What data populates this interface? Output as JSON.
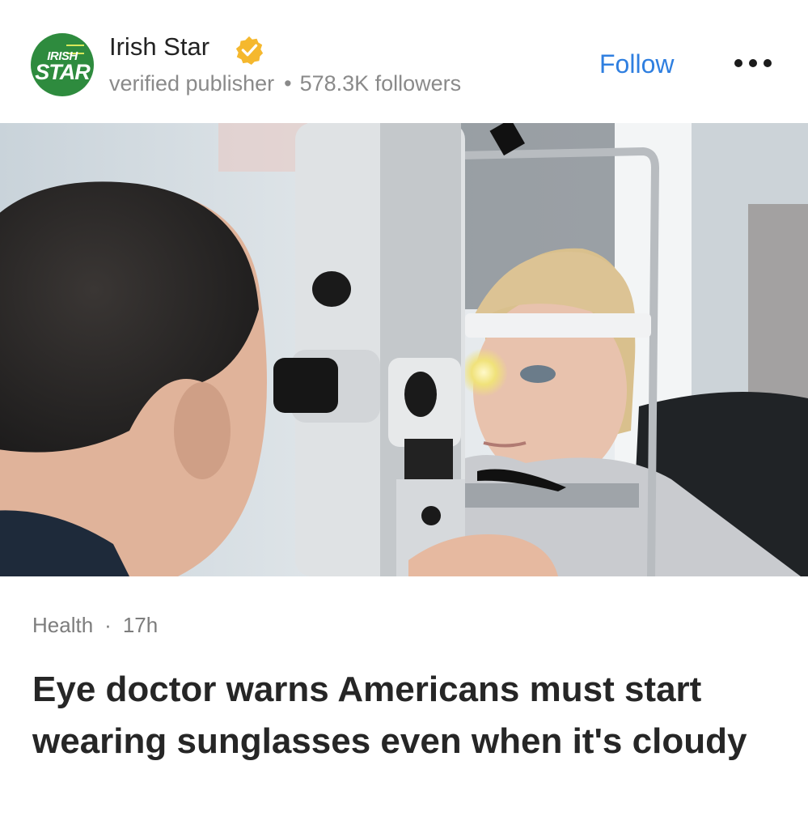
{
  "publisher": {
    "logo_top": "IRISH",
    "logo_bottom": "STAR",
    "name": "Irish Star",
    "verified_icon": "verified-badge-icon",
    "label": "verified publisher",
    "separator": "•",
    "followers": "578.3K followers",
    "follow_label": "Follow",
    "more_icon": "more-horizontal-icon"
  },
  "article": {
    "category": "Health",
    "separator": "·",
    "age": "17h",
    "headline": "Eye doctor warns Americans must start wearing sunglasses even when it's cloudy"
  },
  "colors": {
    "accent": "#2f7fe0",
    "logo_green": "#2e8b3e",
    "verified_gold": "#f5b82e"
  }
}
